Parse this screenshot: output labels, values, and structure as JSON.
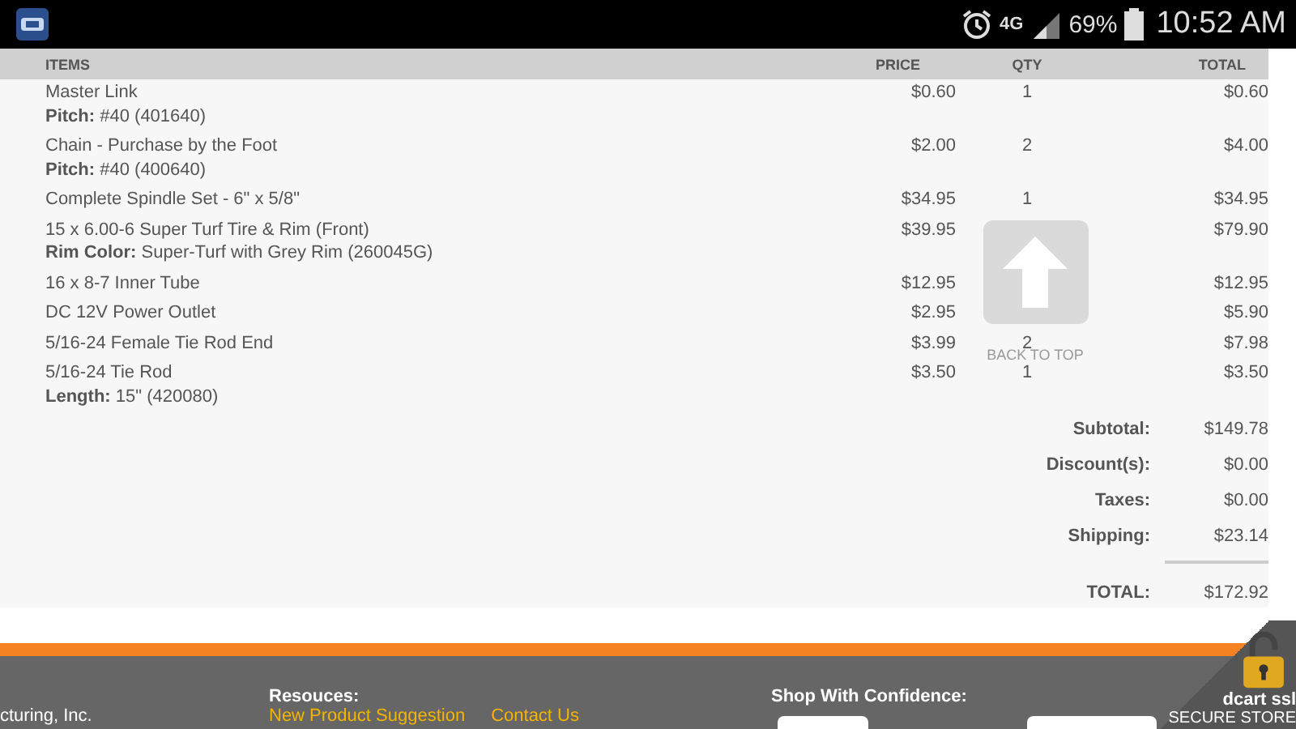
{
  "status_bar": {
    "network": "4G",
    "battery": "69%",
    "time": "10:52 AM"
  },
  "table": {
    "columns": [
      "ITEMS",
      "PRICE",
      "QTY",
      "TOTAL"
    ],
    "rows": [
      {
        "name": "Master Link",
        "option": {
          "label": "Pitch:",
          "value": "#40 (401640)"
        },
        "price": "$0.60",
        "qty": "1",
        "total": "$0.60"
      },
      {
        "name": "Chain - Purchase by the Foot",
        "option": {
          "label": "Pitch:",
          "value": "#40 (400640)"
        },
        "price": "$2.00",
        "qty": "2",
        "total": "$4.00"
      },
      {
        "name": "Complete Spindle Set - 6\" x 5/8\"",
        "price": "$34.95",
        "qty": "1",
        "total": "$34.95"
      },
      {
        "name": "15 x 6.00-6 Super Turf Tire & Rim (Front)",
        "option": {
          "label": "Rim Color:",
          "value": "Super-Turf with Grey Rim (260045G)"
        },
        "price": "$39.95",
        "total": "$79.90"
      },
      {
        "name": "16 x 8-7 Inner Tube",
        "price": "$12.95",
        "total": "$12.95"
      },
      {
        "name": "DC 12V Power Outlet",
        "price": "$2.95",
        "total": "$5.90"
      },
      {
        "name": "5/16-24 Female Tie Rod End",
        "price": "$3.99",
        "qty": "2",
        "total": "$7.98"
      },
      {
        "name": "5/16-24 Tie Rod",
        "option": {
          "label": "Length:",
          "value": "15\" (420080)"
        },
        "price": "$3.50",
        "qty": "1",
        "total": "$3.50"
      }
    ]
  },
  "summary": [
    {
      "label": "Subtotal:",
      "value": "$149.78"
    },
    {
      "label": "Discount(s):",
      "value": "$0.00"
    },
    {
      "label": "Taxes:",
      "value": "$0.00"
    },
    {
      "label": "Shipping:",
      "value": "$23.14"
    }
  ],
  "grand_total": {
    "label": "TOTAL:",
    "value": "$172.92"
  },
  "back_to_top": {
    "label": "BACK TO TOP"
  },
  "footer": {
    "company": "cturing, Inc.",
    "resources": {
      "heading": "Resouces:",
      "links": [
        "New Product Suggestion",
        "Contact Us"
      ]
    },
    "confidence": {
      "heading": "Shop With Confidence:"
    },
    "ssl_badge": {
      "brand": "dcart ssl",
      "caption": "SECURE STORE"
    }
  }
}
